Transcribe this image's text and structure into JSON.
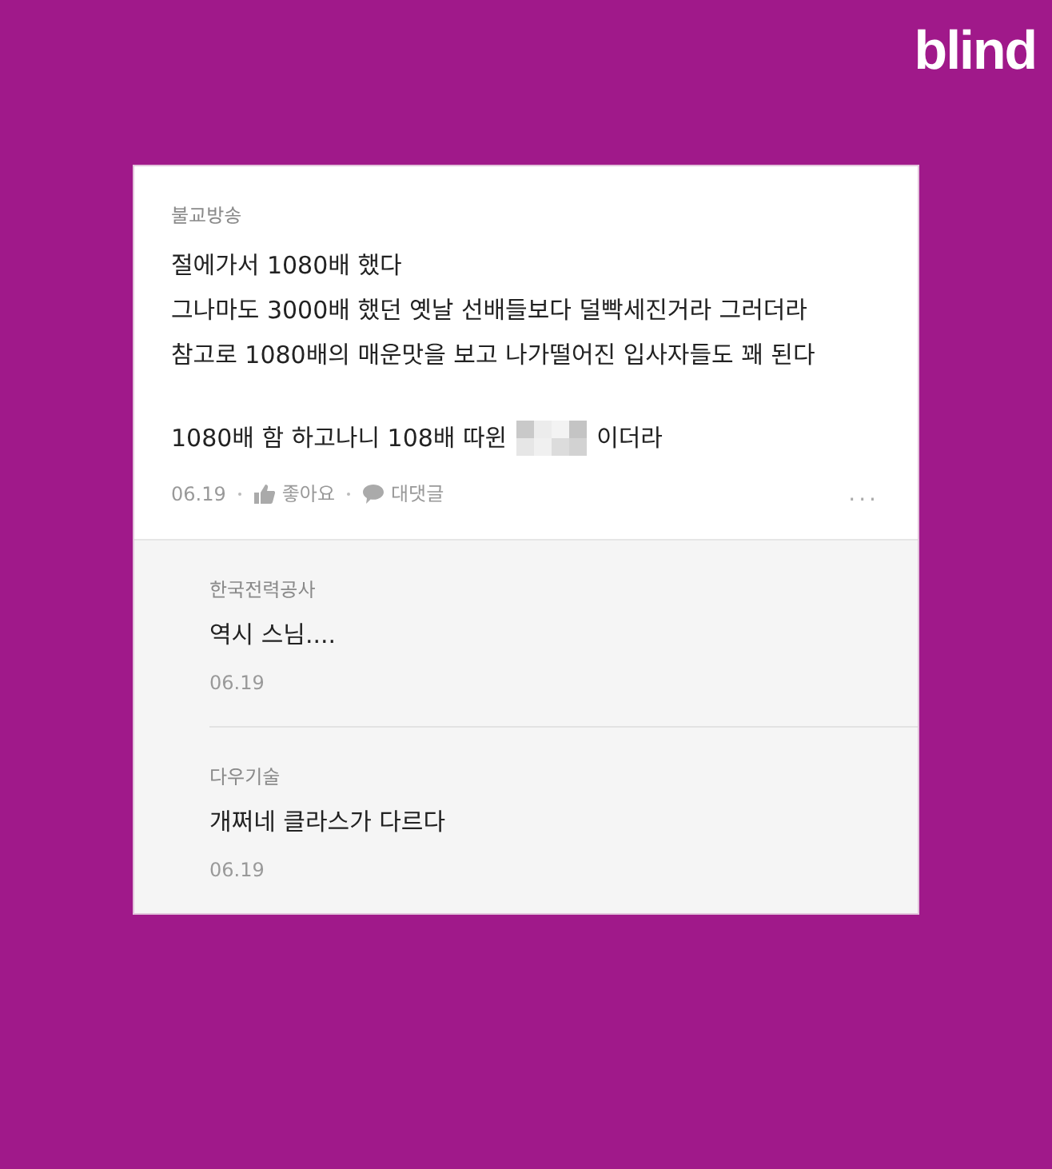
{
  "logo": "blind",
  "post": {
    "company": "불교방송",
    "lines": [
      "절에가서 1080배 했다",
      "그나마도 3000배 했던 옛날 선배들보다 덜빡세진거라 그러더라",
      "참고로 1080배의 매운맛을 보고 나가떨어진 입사자들도 꽤 된다"
    ],
    "last_line": {
      "before": "1080배 함 하고나니 108배 따윈",
      "censored": true,
      "after": "이더라"
    },
    "date": "06.19",
    "like_label": "좋아요",
    "reply_label": "대댓글",
    "more": "..."
  },
  "comments": [
    {
      "company": "한국전력공사",
      "text": "역시 스님....",
      "date": "06.19"
    },
    {
      "company": "다우기술",
      "text": "개쩌네 클라스가 다르다",
      "date": "06.19"
    }
  ]
}
